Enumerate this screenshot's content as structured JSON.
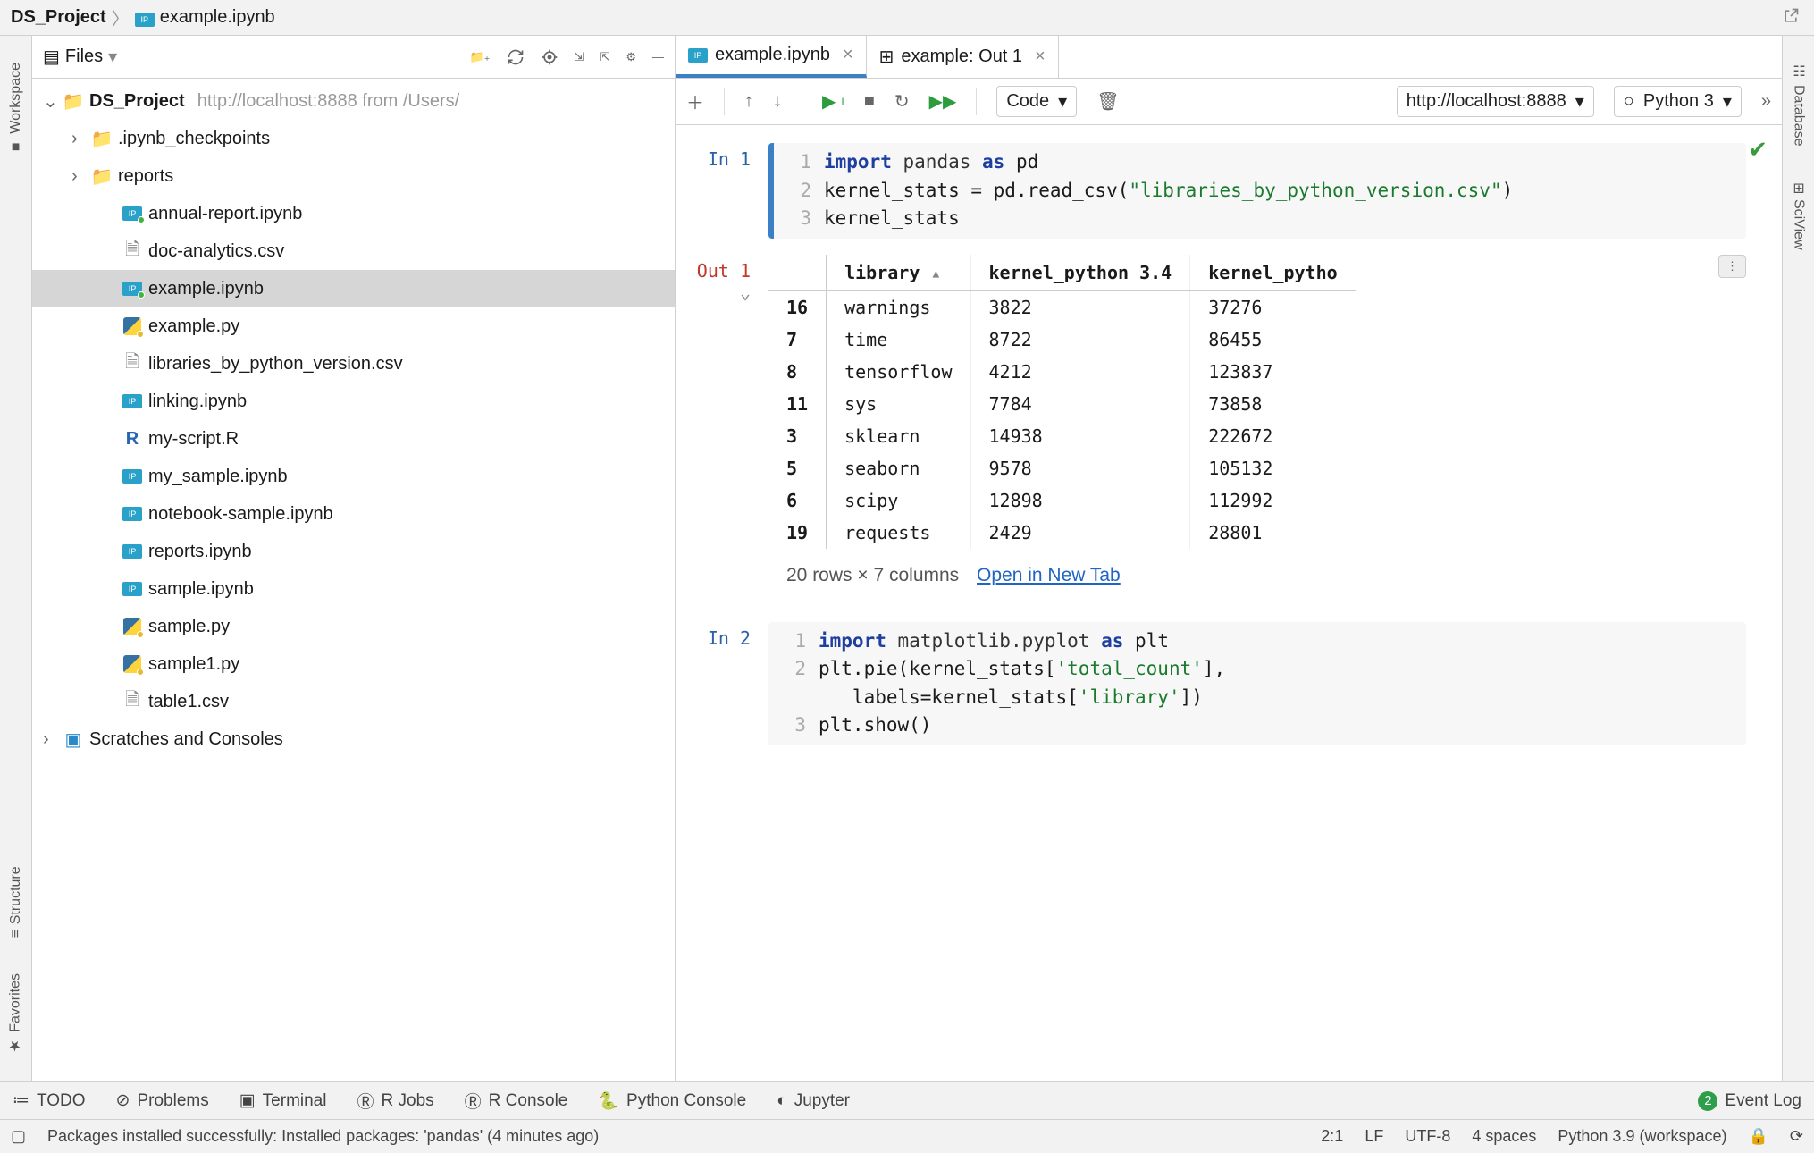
{
  "breadcrumb": {
    "project": "DS_Project",
    "file": "example.ipynb"
  },
  "leftGutter": {
    "workspace": "Workspace",
    "structure": "Structure",
    "favorites": "Favorites"
  },
  "rightGutter": {
    "database": "Database",
    "sciview": "SciView"
  },
  "sideToolbar": {
    "label": "Files"
  },
  "tree": {
    "root": {
      "name": "DS_Project",
      "info": "http://localhost:8888 from /Users/"
    },
    "folders": [
      {
        "name": ".ipynb_checkpoints"
      },
      {
        "name": "reports"
      }
    ],
    "files": [
      {
        "name": "annual-report.ipynb",
        "type": "nb",
        "status": "green"
      },
      {
        "name": "doc-analytics.csv",
        "type": "csv"
      },
      {
        "name": "example.ipynb",
        "type": "nb",
        "status": "green",
        "selected": true
      },
      {
        "name": "example.py",
        "type": "py"
      },
      {
        "name": "libraries_by_python_version.csv",
        "type": "csv"
      },
      {
        "name": "linking.ipynb",
        "type": "nb"
      },
      {
        "name": "my-script.R",
        "type": "r"
      },
      {
        "name": "my_sample.ipynb",
        "type": "nb"
      },
      {
        "name": "notebook-sample.ipynb",
        "type": "nb"
      },
      {
        "name": "reports.ipynb",
        "type": "nb"
      },
      {
        "name": "sample.ipynb",
        "type": "nb"
      },
      {
        "name": "sample.py",
        "type": "py"
      },
      {
        "name": "sample1.py",
        "type": "py"
      },
      {
        "name": "table1.csv",
        "type": "csv"
      }
    ],
    "scratches": "Scratches and Consoles"
  },
  "editorTabs": [
    {
      "label": "example.ipynb",
      "kind": "nb",
      "active": true
    },
    {
      "label": "example: Out 1",
      "kind": "table",
      "active": false
    }
  ],
  "nbToolbar": {
    "cellType": "Code",
    "server": "http://localhost:8888",
    "kernel": "Python 3"
  },
  "cells": {
    "in1": {
      "prompt": "In 1",
      "lines": [
        {
          "n": "1",
          "html": "<span class='kw'>import</span> <span class='mod'>pandas</span> <span class='kw'>as</span> pd"
        },
        {
          "n": "2",
          "html": "kernel_stats = pd.read_csv(<span class='str'>\"libraries_by_python_version.csv\"</span>)"
        },
        {
          "n": "3",
          "html": "kernel_stats"
        }
      ]
    },
    "out1": {
      "prompt": "Out 1",
      "columns": [
        "",
        "library",
        "kernel_python 3.4",
        "kernel_pytho"
      ],
      "rows": [
        [
          "16",
          "warnings",
          "3822",
          "37276"
        ],
        [
          "7",
          "time",
          "8722",
          "86455"
        ],
        [
          "8",
          "tensorflow",
          "4212",
          "123837"
        ],
        [
          "11",
          "sys",
          "7784",
          "73858"
        ],
        [
          "3",
          "sklearn",
          "14938",
          "222672"
        ],
        [
          "5",
          "seaborn",
          "9578",
          "105132"
        ],
        [
          "6",
          "scipy",
          "12898",
          "112992"
        ],
        [
          "19",
          "requests",
          "2429",
          "28801"
        ]
      ],
      "footer": "20 rows × 7 columns",
      "openLink": "Open in New Tab"
    },
    "in2": {
      "prompt": "In 2",
      "lines": [
        {
          "n": "1",
          "html": "<span class='kw'>import</span> <span class='mod'>matplotlib.pyplot</span> <span class='kw'>as</span> plt"
        },
        {
          "n": "2",
          "html": "plt.pie(kernel_stats[<span class='str'>'total_count'</span>],\n   labels=kernel_stats[<span class='str'>'library'</span>])"
        },
        {
          "n": "3",
          "html": "plt.show()"
        }
      ]
    }
  },
  "bottomTools": {
    "todo": "TODO",
    "problems": "Problems",
    "terminal": "Terminal",
    "rjobs": "R Jobs",
    "rconsole": "R Console",
    "pyconsole": "Python Console",
    "jupyter": "Jupyter",
    "eventLog": "Event Log",
    "eventCount": "2"
  },
  "statusBar": {
    "message": "Packages installed successfully: Installed packages: 'pandas' (4 minutes ago)",
    "pos": "2:1",
    "le": "LF",
    "enc": "UTF-8",
    "indent": "4 spaces",
    "interp": "Python 3.9 (workspace)"
  }
}
